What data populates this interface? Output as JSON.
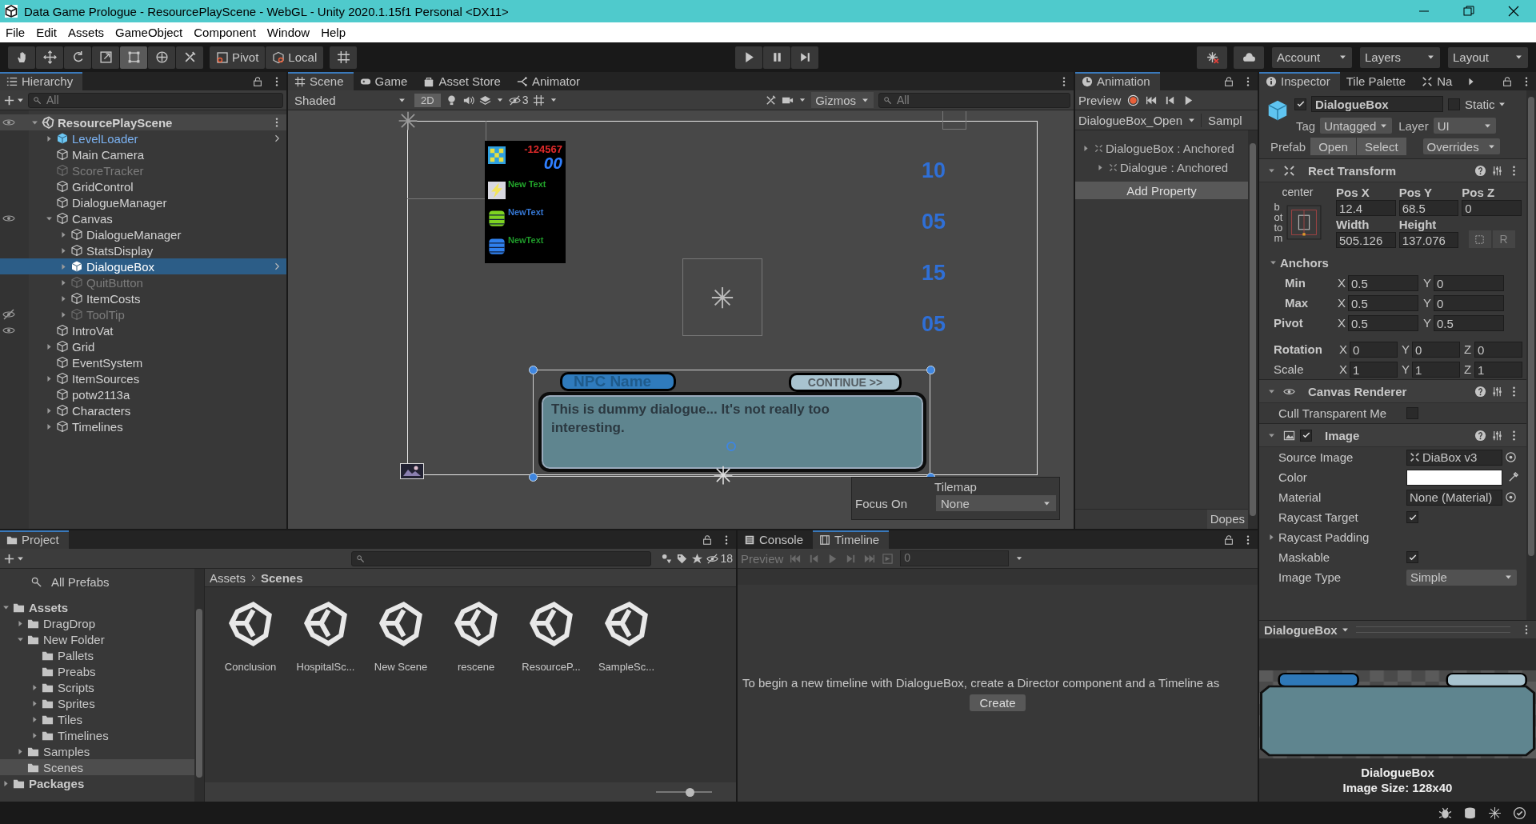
{
  "window": {
    "title": "Data Game Prologue - ResourcePlayScene - WebGL - Unity 2020.1.15f1 Personal <DX11>"
  },
  "menu": [
    "File",
    "Edit",
    "Assets",
    "GameObject",
    "Component",
    "Window",
    "Help"
  ],
  "toolbar": {
    "tools": [
      {
        "kind": "hand",
        "selected": false
      },
      {
        "kind": "move",
        "selected": false
      },
      {
        "kind": "rotate",
        "selected": false
      },
      {
        "kind": "scale",
        "selected": false
      },
      {
        "kind": "rect",
        "selected": true
      },
      {
        "kind": "transform",
        "selected": false
      },
      {
        "kind": "custom",
        "selected": false
      }
    ],
    "pivot": "Pivot",
    "space": "Local",
    "account": "Account",
    "layers": "Layers",
    "layout": "Layout"
  },
  "hierarchy": {
    "title": "Hierarchy",
    "search_placeholder": "All",
    "scene": {
      "name": "ResourcePlayScene",
      "visible": true,
      "children": [
        {
          "name": "LevelLoader",
          "expandable": true,
          "prefab": true,
          "disabled": false,
          "selected": false
        },
        {
          "name": "Main Camera",
          "expandable": false,
          "prefab": false,
          "disabled": false,
          "selected": false
        },
        {
          "name": "ScoreTracker",
          "expandable": false,
          "prefab": false,
          "disabled": true,
          "selected": false
        },
        {
          "name": "GridControl",
          "expandable": false,
          "prefab": false,
          "disabled": false,
          "selected": false
        },
        {
          "name": "DialogueManager",
          "expandable": false,
          "prefab": false,
          "disabled": false,
          "selected": false
        },
        {
          "name": "Canvas",
          "expandable": true,
          "prefab": false,
          "disabled": false,
          "selected": false,
          "visible": true,
          "children": [
            {
              "name": "DialogueManager",
              "expandable": true,
              "prefab": false,
              "disabled": false,
              "selected": false
            },
            {
              "name": "StatsDisplay",
              "expandable": true,
              "prefab": false,
              "disabled": false,
              "selected": false
            },
            {
              "name": "DialogueBox",
              "expandable": true,
              "prefab": true,
              "disabled": false,
              "selected": true
            },
            {
              "name": "QuitButton",
              "expandable": true,
              "prefab": false,
              "disabled": true,
              "selected": false
            },
            {
              "name": "ItemCosts",
              "expandable": true,
              "prefab": false,
              "disabled": false,
              "selected": false
            },
            {
              "name": "ToolTip",
              "expandable": true,
              "prefab": false,
              "disabled": true,
              "selected": false,
              "visible": false
            }
          ]
        },
        {
          "name": "IntroVat",
          "expandable": false,
          "prefab": false,
          "disabled": false,
          "selected": false,
          "visible": true
        },
        {
          "name": "Grid",
          "expandable": true,
          "prefab": false,
          "disabled": false,
          "selected": false
        },
        {
          "name": "EventSystem",
          "expandable": false,
          "prefab": false,
          "disabled": false,
          "selected": false
        },
        {
          "name": "ItemSources",
          "expandable": true,
          "prefab": false,
          "disabled": false,
          "selected": false
        },
        {
          "name": "potw2113a",
          "expandable": false,
          "prefab": false,
          "disabled": false,
          "selected": false
        },
        {
          "name": "Characters",
          "expandable": true,
          "prefab": false,
          "disabled": false,
          "selected": false
        },
        {
          "name": "Timelines",
          "expandable": true,
          "prefab": false,
          "disabled": false,
          "selected": false
        }
      ]
    }
  },
  "scene": {
    "tabs": [
      {
        "label": "Scene",
        "kind": "scene",
        "selected": true
      },
      {
        "label": "Game",
        "kind": "game",
        "selected": false
      },
      {
        "label": "Asset Store",
        "kind": "store",
        "selected": false
      },
      {
        "label": "Animator",
        "kind": "animator",
        "selected": false
      }
    ],
    "shading": "Shaded",
    "mode_2d": {
      "label": "2D",
      "on": true
    },
    "hidden_count": "3",
    "gizmos": "Gizmos",
    "search_placeholder": "All",
    "stats": {
      "score": "-124567",
      "combo": "00",
      "rows": [
        {
          "kind": "bolt",
          "text": "New Text",
          "color": "#22a52a"
        },
        {
          "kind": "coil",
          "text": "NewText",
          "color": "#3577d4"
        },
        {
          "kind": "drum",
          "text": "NewText",
          "color": "#1f9a2a"
        }
      ]
    },
    "counters": [
      "10",
      "05",
      "15",
      "05"
    ],
    "dialogue": {
      "name": "NPC Name",
      "continue": "CONTINUE >>",
      "text": "This is dummy dialogue... It's not really too interesting."
    },
    "tilemap": {
      "title": "Tilemap",
      "focus_label": "Focus On",
      "focus": "None"
    }
  },
  "animation": {
    "tab": "Animation",
    "preview": "Preview",
    "clip": "DialogueBox_Open",
    "samples": "Sampl",
    "properties": [
      {
        "name": "DialogueBox : Anchored",
        "children": [
          {
            "name": "Dialogue : Anchored"
          }
        ]
      }
    ],
    "add_property": "Add Property",
    "footer_tab": "Dopes"
  },
  "inspector": {
    "tabs": [
      {
        "label": "Inspector",
        "selected": true
      },
      {
        "label": "Tile Palette",
        "selected": false
      },
      {
        "label": "Na",
        "selected": false
      }
    ],
    "object": {
      "active": true,
      "name": "DialogueBox",
      "static": false,
      "static_label": "Static",
      "tag_label": "Tag",
      "tag": "Untagged",
      "layer_label": "Layer",
      "layer": "UI",
      "prefab_label": "Prefab",
      "prefab_buttons": [
        "Open",
        "Select"
      ],
      "overrides": "Overrides"
    },
    "rect_transform": {
      "title": "Rect Transform",
      "anchor_h": "center",
      "anchor_v": "bottom",
      "fields": [
        {
          "label": "Pos X",
          "value": "12.4"
        },
        {
          "label": "Pos Y",
          "value": "68.5"
        },
        {
          "label": "Pos Z",
          "value": "0"
        },
        {
          "label": "Width",
          "value": "505.126"
        },
        {
          "label": "Height",
          "value": "137.076"
        }
      ],
      "raw_button": "R",
      "anchors": {
        "label": "Anchors",
        "rows": [
          {
            "label": "Min",
            "values": [
              {
                "axis": "X",
                "value": "0.5"
              },
              {
                "axis": "Y",
                "value": "0"
              }
            ]
          },
          {
            "label": "Max",
            "values": [
              {
                "axis": "X",
                "value": "0.5"
              },
              {
                "axis": "Y",
                "value": "0"
              }
            ]
          }
        ]
      },
      "rows": [
        {
          "label": "Pivot",
          "bold": true,
          "values": [
            {
              "axis": "X",
              "value": "0.5"
            },
            {
              "axis": "Y",
              "value": "0.5"
            }
          ]
        },
        {
          "label": "Rotation",
          "bold": true,
          "values": [
            {
              "axis": "X",
              "value": "0"
            },
            {
              "axis": "Y",
              "value": "0"
            },
            {
              "axis": "Z",
              "value": "0"
            }
          ]
        },
        {
          "label": "Scale",
          "bold": false,
          "values": [
            {
              "axis": "X",
              "value": "1"
            },
            {
              "axis": "Y",
              "value": "1"
            },
            {
              "axis": "Z",
              "value": "1"
            }
          ]
        }
      ]
    },
    "canvas_renderer": {
      "title": "Canvas Renderer",
      "fields": [
        {
          "label": "Cull Transparent Me",
          "kind": "checkbox",
          "checked": false
        }
      ]
    },
    "image": {
      "title": "Image",
      "enabled": true,
      "fields": [
        {
          "label": "Source Image",
          "kind": "sprite",
          "value": "DiaBox v3"
        },
        {
          "label": "Color",
          "kind": "color",
          "color": "#ffffff"
        },
        {
          "label": "Material",
          "kind": "object",
          "value": "None (Material)"
        },
        {
          "label": "Raycast Target",
          "kind": "checkbox",
          "checked": true
        },
        {
          "label": "Raycast Padding",
          "kind": "foldout"
        },
        {
          "label": "Maskable",
          "kind": "checkbox",
          "checked": true
        },
        {
          "label": "Image Type",
          "kind": "dropdown",
          "value": "Simple"
        }
      ]
    },
    "preview": {
      "title": "DialogueBox",
      "name": "DialogueBox",
      "size": "Image Size: 128x40"
    }
  },
  "project": {
    "tab": "Project",
    "hidden_count": "18",
    "favorites": [
      "All Prefabs"
    ],
    "tree": [
      {
        "name": "Assets",
        "expandable": true,
        "selected": false,
        "children": [
          {
            "name": "DragDrop",
            "expandable": true,
            "selected": false
          },
          {
            "name": "New Folder",
            "expandable": true,
            "selected": false,
            "children": [
              {
                "name": "Pallets",
                "expandable": false,
                "selected": false
              },
              {
                "name": "Preabs",
                "expandable": false,
                "selected": false
              },
              {
                "name": "Scripts",
                "expandable": true,
                "selected": false
              },
              {
                "name": "Sprites",
                "expandable": true,
                "selected": false
              },
              {
                "name": "Tiles",
                "expandable": true,
                "selected": false
              },
              {
                "name": "Timelines",
                "expandable": true,
                "selected": false
              }
            ]
          },
          {
            "name": "Samples",
            "expandable": true,
            "selected": false
          },
          {
            "name": "Scenes",
            "expandable": false,
            "selected": true
          }
        ]
      },
      {
        "name": "Packages",
        "expandable": true,
        "selected": false
      }
    ],
    "breadcrumb": [
      "Assets",
      "Scenes"
    ],
    "assets": [
      "Conclusion",
      "HospitalSc...",
      "New Scene",
      "rescene",
      "ResourceP...",
      "SampleSc..."
    ],
    "zoom": {
      "level": 0.6
    }
  },
  "timeline": {
    "tabs": [
      {
        "label": "Console",
        "kind": "console",
        "selected": false
      },
      {
        "label": "Timeline",
        "kind": "timeline",
        "selected": true
      }
    ],
    "preview": "Preview",
    "frame": "0",
    "message": "To begin a new timeline with DialogueBox, create a Director component and a Timeline as",
    "button": "Create"
  }
}
